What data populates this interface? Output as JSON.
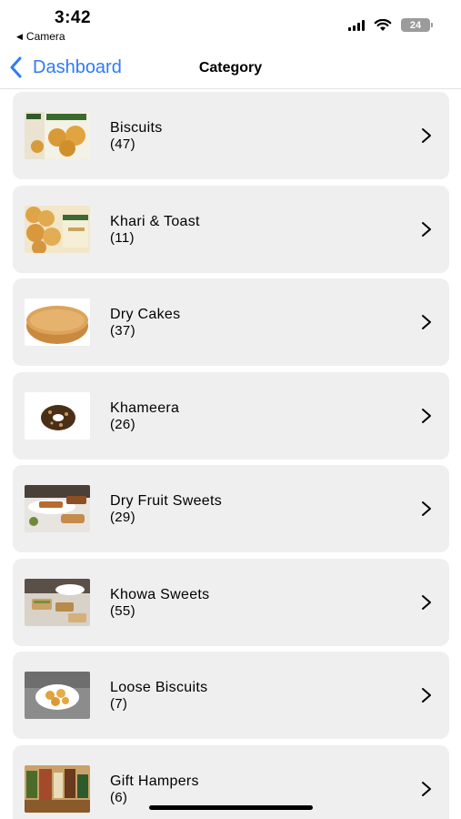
{
  "status_bar": {
    "time": "3:42",
    "back_app": "Camera",
    "battery": "24"
  },
  "nav": {
    "back_label": "Dashboard",
    "title": "Category"
  },
  "categories": [
    {
      "name": "Biscuits",
      "count": "(47)",
      "image": "biscuits-image"
    },
    {
      "name": "Khari & Toast",
      "count": "(11)",
      "image": "khari-toast-image"
    },
    {
      "name": "Dry Cakes",
      "count": "(37)",
      "image": "dry-cake-image"
    },
    {
      "name": "Khameera",
      "count": "(26)",
      "image": "khameera-image"
    },
    {
      "name": "Dry Fruit Sweets",
      "count": "(29)",
      "image": "dry-fruit-sweets-image"
    },
    {
      "name": "Khowa Sweets",
      "count": "(55)",
      "image": "khowa-sweets-image"
    },
    {
      "name": "Loose Biscuits",
      "count": "(7)",
      "image": "loose-biscuits-image"
    },
    {
      "name": "Gift Hampers",
      "count": "(6)",
      "image": "gift-hampers-image"
    }
  ],
  "colors": {
    "accent": "#2f7bf5",
    "card_bg": "#efefef"
  }
}
